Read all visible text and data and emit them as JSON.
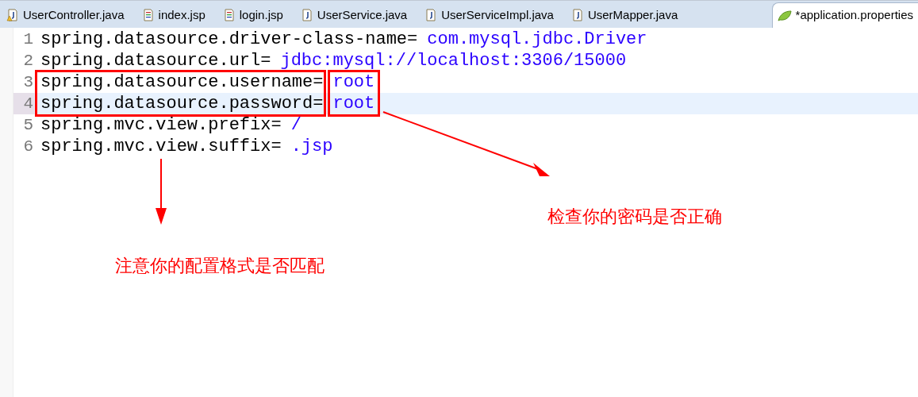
{
  "tabs": [
    {
      "label": "UserController.java",
      "kind": "java-warning",
      "selected": false
    },
    {
      "label": "index.jsp",
      "kind": "jsp",
      "selected": false
    },
    {
      "label": "login.jsp",
      "kind": "jsp",
      "selected": false
    },
    {
      "label": "UserService.java",
      "kind": "java",
      "selected": false
    },
    {
      "label": "UserServiceImpl.java",
      "kind": "java",
      "selected": false
    },
    {
      "label": "UserMapper.java",
      "kind": "java",
      "selected": false
    },
    {
      "label": "*application.properties",
      "kind": "properties",
      "selected": true
    }
  ],
  "lines": [
    {
      "number": "1",
      "key": "spring.datasource.driver-class-name=",
      "value": "com.mysql.jdbc.Driver",
      "current": false
    },
    {
      "number": "2",
      "key": "spring.datasource.url=",
      "value": "jdbc:mysql://localhost:3306/15000",
      "current": false
    },
    {
      "number": "3",
      "key": "spring.datasource.username=",
      "value": "root",
      "current": false
    },
    {
      "number": "4",
      "key": "spring.datasource.password=",
      "value": "root",
      "current": true
    },
    {
      "number": "5",
      "key": "spring.mvc.view.prefix=",
      "value": "/",
      "current": false
    },
    {
      "number": "6",
      "key": "spring.mvc.view.suffix=",
      "value": ".jsp",
      "current": false
    }
  ],
  "annotations": [
    {
      "text": "检查你的密码是否正确"
    },
    {
      "text": "注意你的配置格式是否匹配"
    }
  ]
}
